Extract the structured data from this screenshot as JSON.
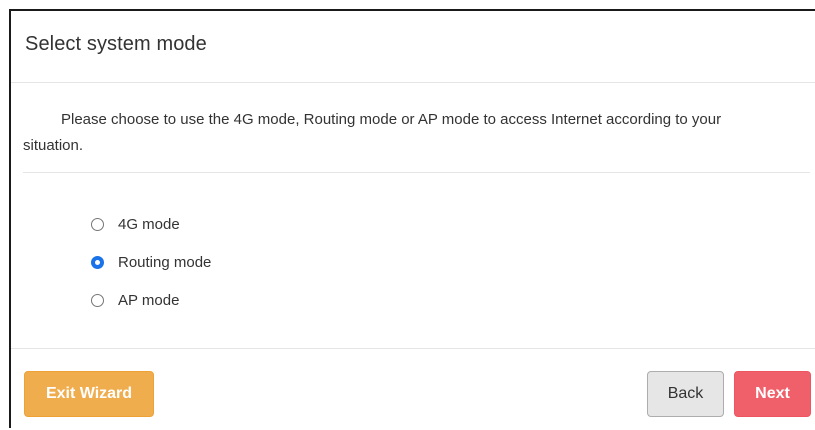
{
  "dialog": {
    "title": "Select system mode",
    "description": "Please choose to use the 4G mode, Routing mode or AP mode to access Internet according to your situation."
  },
  "modes": [
    {
      "label": "4G mode",
      "selected": false
    },
    {
      "label": "Routing mode",
      "selected": true
    },
    {
      "label": "AP mode",
      "selected": false
    }
  ],
  "footer": {
    "exit_label": "Exit Wizard",
    "back_label": "Back",
    "next_label": "Next"
  },
  "colors": {
    "exit_button": "#f0ad4e",
    "back_button": "#e6e6e6",
    "next_button": "#f0606a",
    "radio_selected": "#1a73e8"
  }
}
